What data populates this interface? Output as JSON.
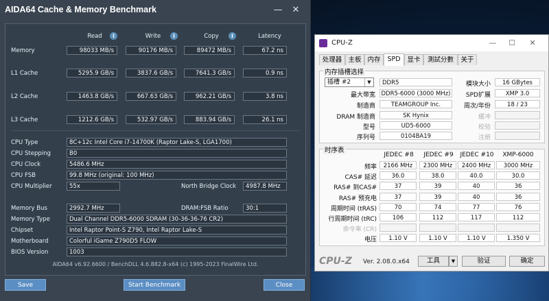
{
  "aida": {
    "title": "AIDA64 Cache & Memory Benchmark",
    "window_buttons": {
      "minimize": "—",
      "close": "✕"
    },
    "headers": {
      "read": "Read",
      "write": "Write",
      "copy": "Copy",
      "latency": "Latency"
    },
    "info_glyph": "i",
    "bench_rows": [
      {
        "label": "Memory",
        "read": "98033 MB/s",
        "write": "90176 MB/s",
        "copy": "89472 MB/s",
        "latency": "67.2 ns"
      },
      {
        "label": "L1 Cache",
        "read": "5295.9 GB/s",
        "write": "3837.6 GB/s",
        "copy": "7641.3 GB/s",
        "latency": "0.9 ns"
      },
      {
        "label": "L2 Cache",
        "read": "1463.8 GB/s",
        "write": "667.63 GB/s",
        "copy": "962.21 GB/s",
        "latency": "3.8 ns"
      },
      {
        "label": "L3 Cache",
        "read": "1212.6 GB/s",
        "write": "532.97 GB/s",
        "copy": "883.94 GB/s",
        "latency": "26.1 ns"
      }
    ],
    "cpu": {
      "type_label": "CPU Type",
      "type": "8C+12c Intel Core i7-14700K  (Raptor Lake-S, LGA1700)",
      "stepping_label": "CPU Stepping",
      "stepping": "B0",
      "clock_label": "CPU Clock",
      "clock": "5486.6 MHz",
      "fsb_label": "CPU FSB",
      "fsb": "99.8 MHz  (original: 100 MHz)",
      "multiplier_label": "CPU Multiplier",
      "multiplier": "55x",
      "nb_clock_label": "North Bridge Clock",
      "nb_clock": "4987.8 MHz"
    },
    "system": {
      "membus_label": "Memory Bus",
      "membus": "2992.7 MHz",
      "ratio_label": "DRAM:FSB Ratio",
      "ratio": "30:1",
      "memtype_label": "Memory Type",
      "memtype": "Dual Channel DDR5-6000 SDRAM  (30-36-36-76 CR2)",
      "chipset_label": "Chipset",
      "chipset": "Intel Raptor Point-S Z790, Intel Raptor Lake-S",
      "mobo_label": "Motherboard",
      "mobo": "Colorful iGame Z790D5 FLOW",
      "bios_label": "BIOS Version",
      "bios": "1003"
    },
    "footer": "AIDA64 v6.92.6600 / BenchDLL 4.6.882.8-x64  (c) 1995-2023 FinalWire Ltd.",
    "buttons": {
      "save": "Save",
      "start": "Start Benchmark",
      "close": "Close"
    }
  },
  "cpuz": {
    "title": "CPU-Z",
    "window_buttons": {
      "minimize": "—",
      "maximize": "☐",
      "close": "✕"
    },
    "tabs": [
      "处理器",
      "主板",
      "内存",
      "SPD",
      "显卡",
      "測試分數",
      "关于"
    ],
    "active_tab": "SPD",
    "slot_group_title": "内存插槽选择",
    "slot_select": "插槽 #2",
    "type_value": "DDR5",
    "fields_left": [
      {
        "label": "最大带宽",
        "value": "DDR5-6000 (3000 MHz)"
      },
      {
        "label": "制造商",
        "value": "TEAMGROUP Inc."
      },
      {
        "label": "DRAM 制造商",
        "value": "SK Hynix"
      },
      {
        "label": "型号",
        "value": "UD5-6000"
      },
      {
        "label": "序列号",
        "value": "0104BA19"
      }
    ],
    "fields_right": [
      {
        "label": "模块大小",
        "value": "16 GBytes",
        "dim": false
      },
      {
        "label": "SPD扩展",
        "value": "XMP 3.0",
        "dim": false
      },
      {
        "label": "周次/年份",
        "value": "18 / 23",
        "dim": false
      },
      {
        "label": "缓冲",
        "value": "",
        "dim": true
      },
      {
        "label": "校验",
        "value": "",
        "dim": true
      },
      {
        "label": "注册",
        "value": "",
        "dim": true
      }
    ],
    "timing_group_title": "时序表",
    "timing_headers": [
      "JEDEC #8",
      "JEDEC #9",
      "JEDEC #10",
      "XMP-6000"
    ],
    "timing_rows": [
      {
        "label": "频率",
        "values": [
          "2166 MHz",
          "2300 MHz",
          "2400 MHz",
          "3000 MHz"
        ],
        "dim": false
      },
      {
        "label": "CAS# 延迟",
        "values": [
          "36.0",
          "38.0",
          "40.0",
          "30.0"
        ],
        "dim": false
      },
      {
        "label": "RAS# 到CAS#",
        "values": [
          "37",
          "39",
          "40",
          "36"
        ],
        "dim": false
      },
      {
        "label": "RAS# 预充电",
        "values": [
          "37",
          "39",
          "40",
          "36"
        ],
        "dim": false
      },
      {
        "label": "周期时间 (tRAS)",
        "values": [
          "70",
          "74",
          "77",
          "76"
        ],
        "dim": false
      },
      {
        "label": "行周期时间 (tRC)",
        "values": [
          "106",
          "112",
          "117",
          "112"
        ],
        "dim": false
      },
      {
        "label": "命令率 (CR)",
        "values": [
          "",
          "",
          "",
          ""
        ],
        "dim": true
      },
      {
        "label": "电压",
        "values": [
          "1.10 V",
          "1.10 V",
          "1.10 V",
          "1.350 V"
        ],
        "dim": false
      }
    ],
    "brand": "CPU-Z",
    "version": "Ver. 2.08.0.x64",
    "buttons": {
      "tools": "工具",
      "tools_arrow": "▼",
      "validate": "验证",
      "ok": "确定"
    }
  }
}
